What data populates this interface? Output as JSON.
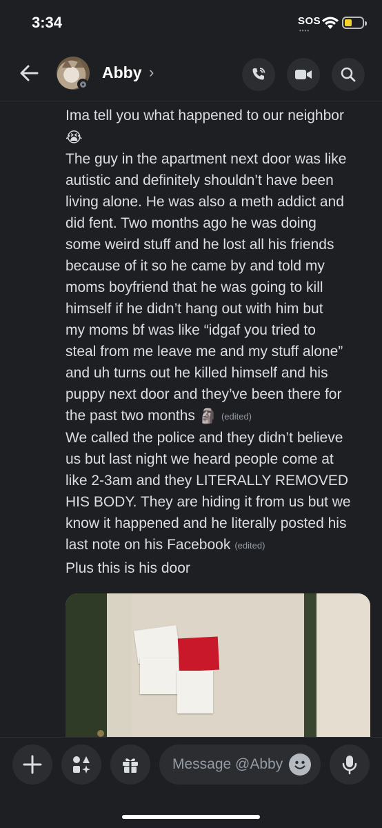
{
  "status_bar": {
    "time": "3:34",
    "sos": "SOS"
  },
  "header": {
    "contact_name": "Abby",
    "chevron": "›"
  },
  "messages": {
    "lines": [
      "Ima tell you what happened to our neighbor",
      "The guy in the apartment next door was like",
      "autistic and definitely shouldn’t have been",
      "living alone. He was also a meth addict and",
      "did fent. Two months ago he was doing",
      "some weird stuff and he lost all his friends",
      "because of it so he came by and told my",
      "moms boyfriend that he was going to kill",
      "himself if he didn’t hang out with him but",
      "my moms bf was like “idgaf you tried to",
      "steal from me leave me and my stuff alone”",
      "and uh turns out he killed himself and his",
      "puppy next door and they’ve been there for",
      "the past two months",
      "We called the police and they didn’t believe",
      "us but last night we heard people come at",
      "like 2-3am and they LITERALLY REMOVED",
      "HIS BODY. They are hiding it from us but we",
      "know it happened and he literally posted his",
      "last note on his Facebook",
      "Plus this is his door"
    ],
    "emoji_1": "😭",
    "emoji_2": "🗿",
    "edited_1": "(edited)",
    "edited_2": "(edited)"
  },
  "composer": {
    "placeholder": "Message @Abby"
  },
  "colors": {
    "background": "#1e1f22",
    "button": "#2b2d31",
    "text": "#dbdee1",
    "muted": "#949ba4"
  },
  "icons": [
    "back-arrow-icon",
    "phone-icon",
    "video-camera-icon",
    "search-icon",
    "plus-icon",
    "apps-icon",
    "gift-icon",
    "emoji-icon",
    "microphone-icon"
  ]
}
